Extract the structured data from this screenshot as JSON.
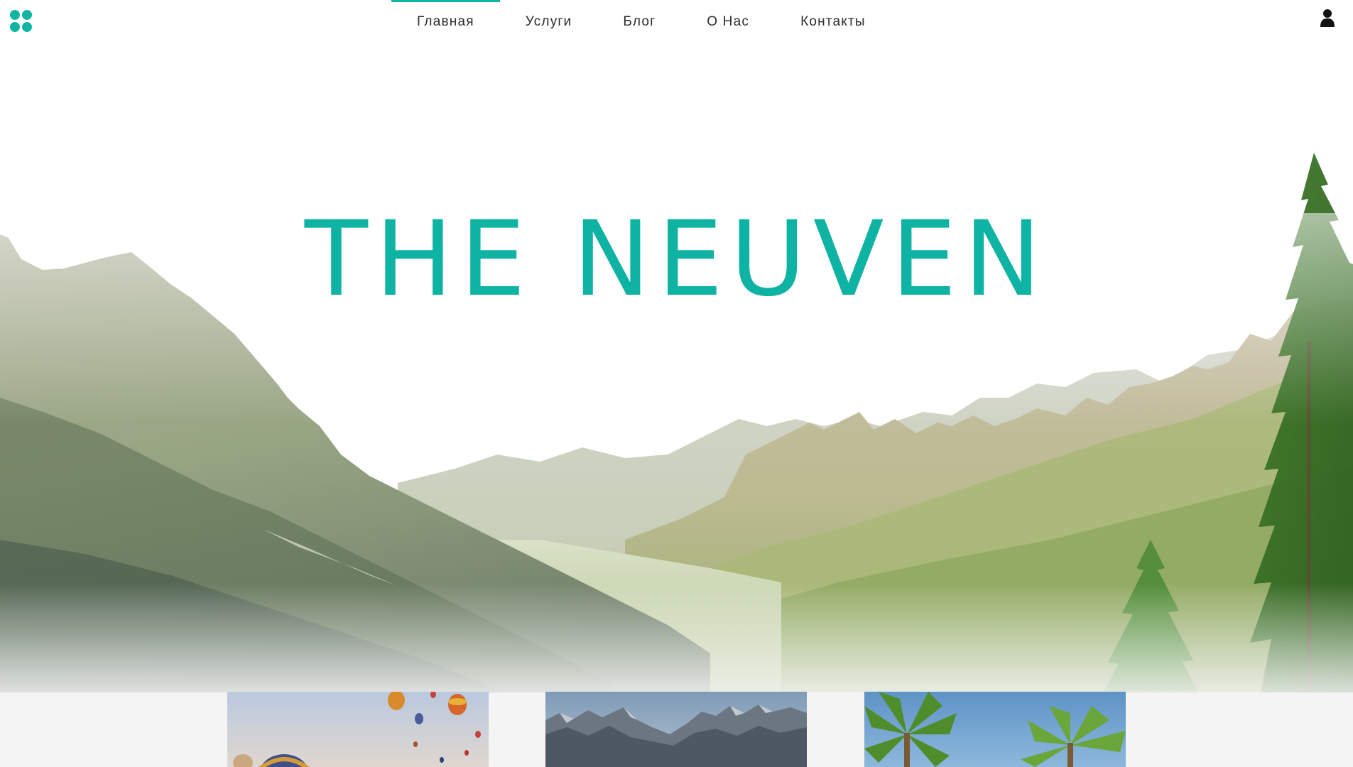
{
  "nav": {
    "items": [
      {
        "label": "Главная",
        "active": true
      },
      {
        "label": "Услуги",
        "active": false
      },
      {
        "label": "Блог",
        "active": false
      },
      {
        "label": "О Нас",
        "active": false
      },
      {
        "label": "Контакты",
        "active": false
      }
    ],
    "logo_icon": "four-dots-logo-icon",
    "user_icon": "user-icon"
  },
  "hero": {
    "title": "THE NEUVEN",
    "background": "mountain-valley-photo"
  },
  "cards": [
    {
      "image": "hot-air-balloons-photo"
    },
    {
      "image": "rocky-mountain-peaks-photo"
    },
    {
      "image": "palm-trees-photo"
    }
  ],
  "colors": {
    "accent": "#12b5a5",
    "nav_text": "#2c2c2c",
    "cards_band": "#f4f4f4"
  }
}
